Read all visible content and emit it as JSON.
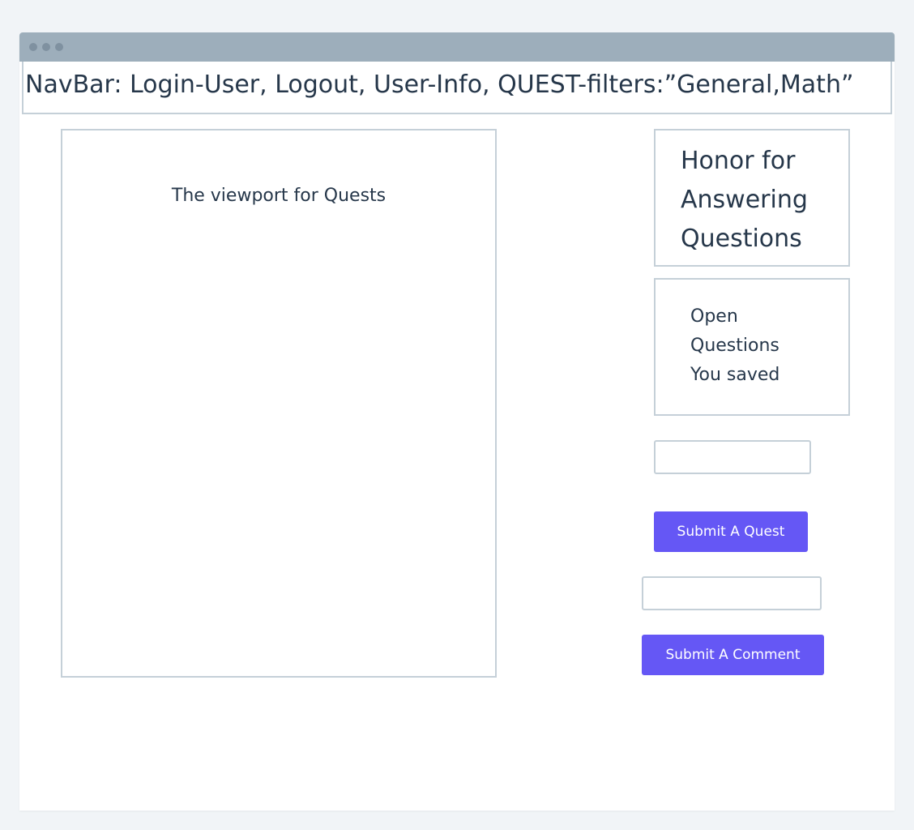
{
  "navbar": {
    "text": "NavBar: Login-User, Logout, User-Info, QUEST-filters:”General,Math”"
  },
  "viewport": {
    "label": "The viewport for Quests"
  },
  "honor_panel": {
    "label": "Honor for Answering Questions"
  },
  "saved_panel": {
    "lines": [
      "Open",
      "Questions",
      "You saved"
    ]
  },
  "quest_form": {
    "input_value": "",
    "button_label": "Submit A Quest"
  },
  "comment_form": {
    "input_value": "",
    "button_label": "Submit A Comment"
  },
  "colors": {
    "page_background": "#f1f4f7",
    "title_bar": "#9daebb",
    "border": "#c5d0d8",
    "text": "#26374a",
    "button": "#6557f5",
    "button_text": "#ffffff"
  }
}
